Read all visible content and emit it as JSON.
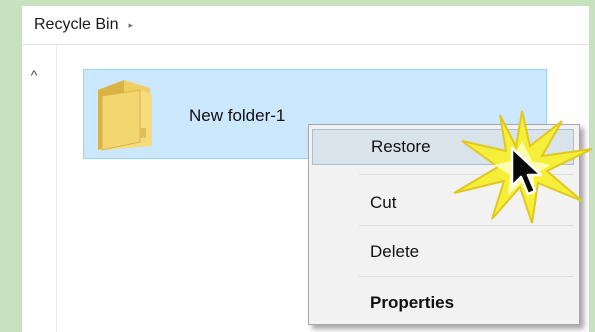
{
  "breadcrumb": {
    "label": "Recycle Bin",
    "chevron": "▸"
  },
  "navpane": {
    "collapse_icon": "^"
  },
  "file": {
    "name": "New folder-1",
    "icon": "folder-icon"
  },
  "context_menu": {
    "items": [
      {
        "label": "Restore",
        "highlighted": true
      },
      {
        "label": "Cut"
      },
      {
        "label": "Delete"
      },
      {
        "label": "Properties",
        "bold": true
      }
    ]
  },
  "colors": {
    "background": "#c7e2bf",
    "selection": "#cce8ff",
    "menu": "#f2f2f2",
    "burst": "#f5ef3a"
  }
}
